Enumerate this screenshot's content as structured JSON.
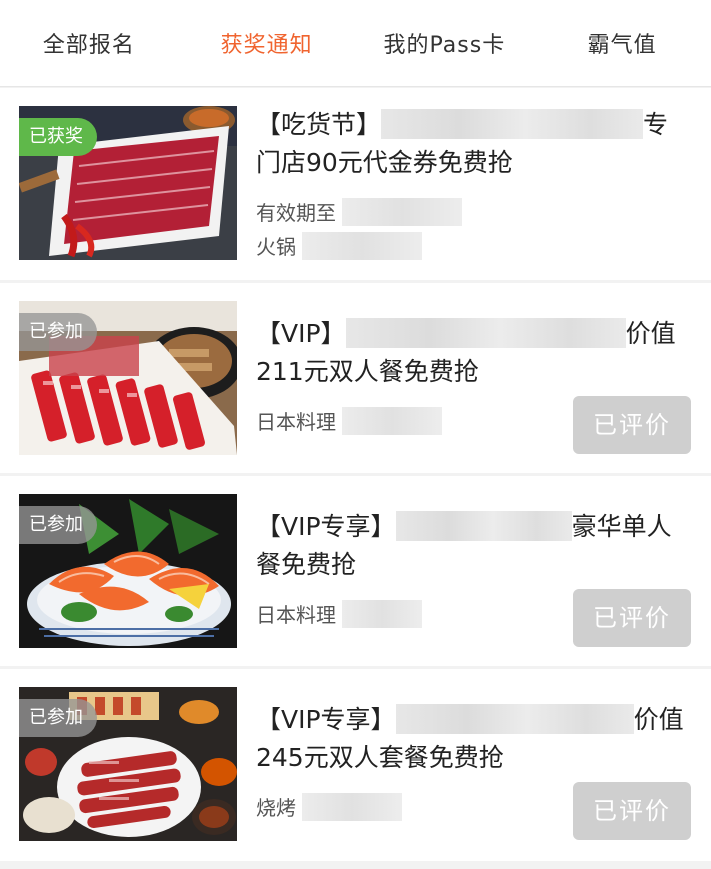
{
  "tabs": [
    {
      "label": "全部报名"
    },
    {
      "label": "获奖通知"
    },
    {
      "label": "我的Pass卡"
    },
    {
      "label": "霸气值"
    }
  ],
  "active_tab": 1,
  "colors": {
    "accent": "#f0642f",
    "won_badge": "#5fb84a",
    "button_disabled": "#cfcfcf"
  },
  "cards": [
    {
      "badge": "已获奖",
      "title_prefix": "【吃货节】",
      "title_mid": "专",
      "title_rest": "门店90元代金券免费抢",
      "meta1_label": "有效期至",
      "meta2_label": "火锅",
      "image": "sliced beef on plate"
    },
    {
      "badge": "已参加",
      "title_prefix": "【VIP】",
      "title_mid": "价值",
      "title_rest": "211元双人餐免费抢",
      "meta1_label": "日本料理",
      "button": "已评价",
      "image": "japanese bbq meat platter"
    },
    {
      "badge": "已参加",
      "title_prefix": "【VIP专享】",
      "title_mid": "豪华单人",
      "title_rest": "餐免费抢",
      "meta1_label": "日本料理",
      "button": "已评价",
      "image": "salmon sashimi bowl"
    },
    {
      "badge": "已参加",
      "title_prefix": "【VIP专享】",
      "title_mid": "价值",
      "title_rest": "245元双人套餐免费抢",
      "meta1_label": "烧烤",
      "button": "已评价",
      "image": "korean bbq set"
    }
  ]
}
